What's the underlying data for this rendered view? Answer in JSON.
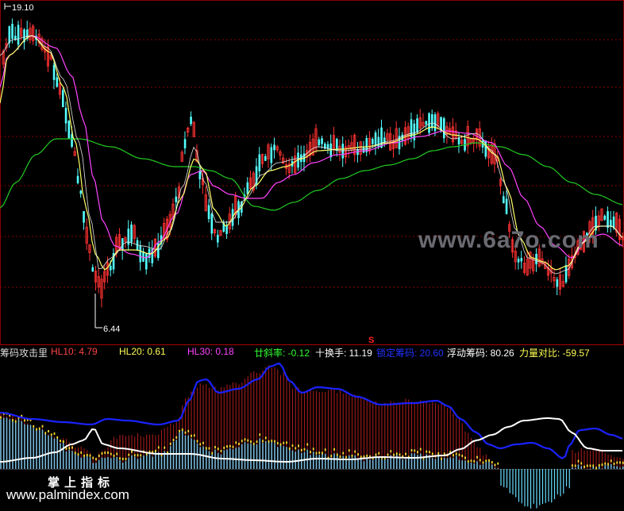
{
  "colors": {
    "up": "#ff3232",
    "down": "#54ffff",
    "hl10": "#ffff66",
    "hl20": "#ff44ff",
    "hl30": "#22cc22",
    "grid": "#8b0000",
    "separator": "#aa0000",
    "chip_line": "#1a22ff",
    "float_line": "#ffffff",
    "neg_bars": "#66ddff"
  },
  "chart_data": [
    {
      "type": "candlestick",
      "price_labels": {
        "high": "19.10",
        "low": "6.44"
      },
      "high_price": 19.1,
      "low_price": 6.44,
      "marker": "S",
      "series": [
        {
          "name": "HL10",
          "color": "#ffff66"
        },
        {
          "name": "HL20",
          "color": "#ff44ff"
        },
        {
          "name": "HL30",
          "color": "#22cc22"
        }
      ],
      "grid": true
    },
    {
      "type": "bar",
      "indicator_name": "筹码攻击里",
      "readouts": [
        {
          "label": "HL10: ",
          "value": "4.79",
          "color": "#ff4444"
        },
        {
          "label": "HL20: ",
          "value": "0.61",
          "color": "#ffff55"
        },
        {
          "label": "HL30: ",
          "value": "0.18",
          "color": "#ff44ff"
        },
        {
          "label": "廿斜率: ",
          "value": "-0.12",
          "color": "#33ff33"
        },
        {
          "label": "十换手: ",
          "value": "11.19",
          "color": "#ffffff"
        },
        {
          "label": "锁定筹码: ",
          "value": "20.60",
          "color": "#2233ff"
        },
        {
          "label": "浮动筹码: ",
          "value": "80.26",
          "color": "#ffffff"
        },
        {
          "label": "力量对比: ",
          "value": "-59.57",
          "color": "#ffff55"
        }
      ],
      "lines": [
        {
          "name": "锁定筹码",
          "color": "#1a22ff"
        },
        {
          "name": "浮动筹码",
          "color": "#ffffff"
        }
      ]
    }
  ],
  "watermarks": {
    "site_top": "www.6a7o.com",
    "brand": "掌上指标",
    "site_bottom": "www.palmindex.com"
  }
}
